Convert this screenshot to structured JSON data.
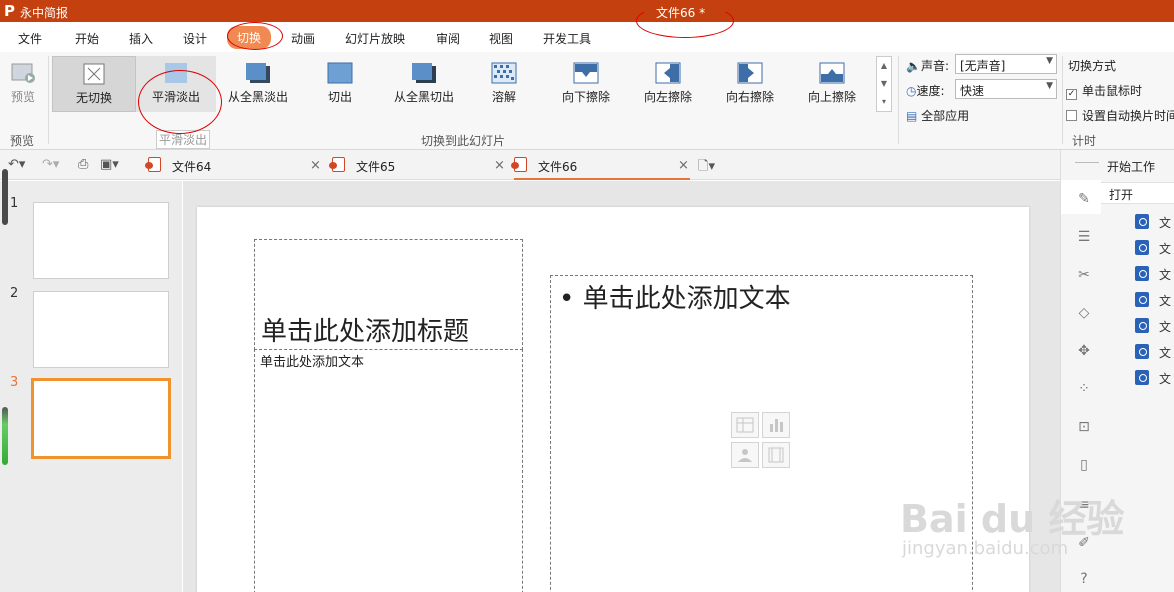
{
  "app": {
    "name": "永中简报",
    "logo": "P",
    "doc_title": "文件66 *"
  },
  "menu": [
    {
      "label": "文件"
    },
    {
      "label": "开始"
    },
    {
      "label": "插入"
    },
    {
      "label": "设计"
    },
    {
      "label": "切换",
      "active": true
    },
    {
      "label": "动画"
    },
    {
      "label": "幻灯片放映"
    },
    {
      "label": "审阅"
    },
    {
      "label": "视图"
    },
    {
      "label": "开发工具"
    }
  ],
  "ribbon": {
    "preview": {
      "label": "预览",
      "group_label": "预览"
    },
    "transitions": [
      {
        "label": "无切换",
        "selected": true
      },
      {
        "label": "平滑淡出"
      },
      {
        "label": "从全黑淡出"
      },
      {
        "label": "切出"
      },
      {
        "label": "从全黑切出"
      },
      {
        "label": "溶解"
      },
      {
        "label": "向下擦除"
      },
      {
        "label": "向左擦除"
      },
      {
        "label": "向右擦除"
      },
      {
        "label": "向上擦除"
      }
    ],
    "tooltip": "平滑淡出",
    "group_label": "切换到此幻灯片",
    "sound_label": "声音:",
    "sound_value": "[无声音]",
    "speed_label": "速度:",
    "speed_value": "快速",
    "apply_all": "全部应用",
    "advance_title": "切换方式",
    "on_click": "单击鼠标时",
    "auto_advance": "设置自动换片时间",
    "timing_group": "计时"
  },
  "doc_tabs": [
    {
      "name": "文件64"
    },
    {
      "name": "文件65"
    },
    {
      "name": "文件66",
      "active": true
    }
  ],
  "slides": [
    {
      "num": "1"
    },
    {
      "num": "2"
    },
    {
      "num": "3",
      "current": true
    }
  ],
  "slide": {
    "title_placeholder": "单击此处添加标题",
    "subtitle_placeholder": "单击此处添加文本",
    "body_placeholder": "• 单击此处添加文本"
  },
  "right_panel": {
    "start": "开始工作",
    "open": "打开",
    "file_prefix": "文"
  },
  "watermark": {
    "main": "Bai du 经验",
    "sub": "jingyan.baidu.com"
  },
  "colors": {
    "titlebar": "#c4400e",
    "accent": "#f08a52",
    "current_slide_border": "#f0922d"
  }
}
